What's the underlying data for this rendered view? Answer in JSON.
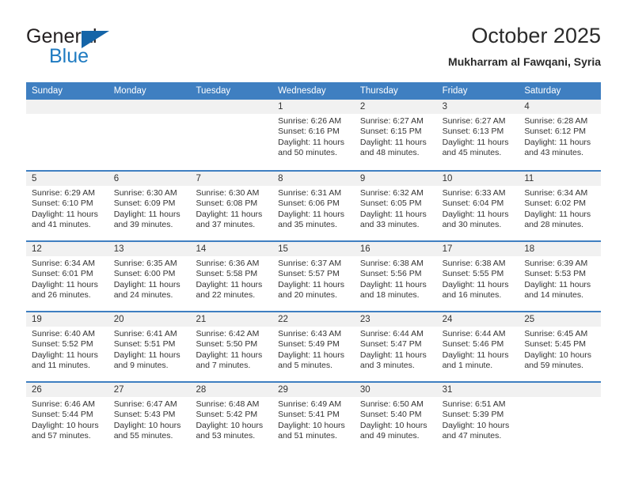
{
  "brand": {
    "name_part1": "General",
    "name_part2": "Blue",
    "accent_color": "#1f7bc1",
    "triangle_color": "#1565a8"
  },
  "header": {
    "month_title": "October 2025",
    "location": "Mukharram al Fawqani, Syria"
  },
  "calendar": {
    "header_color": "#3f7fc1",
    "day_number_band_color": "#f1f1f1",
    "weekdays": [
      "Sunday",
      "Monday",
      "Tuesday",
      "Wednesday",
      "Thursday",
      "Friday",
      "Saturday"
    ],
    "weeks": [
      [
        {
          "date": "",
          "sunrise": "",
          "sunset": "",
          "daylight": "",
          "empty": true
        },
        {
          "date": "",
          "sunrise": "",
          "sunset": "",
          "daylight": "",
          "empty": true
        },
        {
          "date": "",
          "sunrise": "",
          "sunset": "",
          "daylight": "",
          "empty": true
        },
        {
          "date": "1",
          "sunrise": "Sunrise: 6:26 AM",
          "sunset": "Sunset: 6:16 PM",
          "daylight": "Daylight: 11 hours and 50 minutes."
        },
        {
          "date": "2",
          "sunrise": "Sunrise: 6:27 AM",
          "sunset": "Sunset: 6:15 PM",
          "daylight": "Daylight: 11 hours and 48 minutes."
        },
        {
          "date": "3",
          "sunrise": "Sunrise: 6:27 AM",
          "sunset": "Sunset: 6:13 PM",
          "daylight": "Daylight: 11 hours and 45 minutes."
        },
        {
          "date": "4",
          "sunrise": "Sunrise: 6:28 AM",
          "sunset": "Sunset: 6:12 PM",
          "daylight": "Daylight: 11 hours and 43 minutes."
        }
      ],
      [
        {
          "date": "5",
          "sunrise": "Sunrise: 6:29 AM",
          "sunset": "Sunset: 6:10 PM",
          "daylight": "Daylight: 11 hours and 41 minutes."
        },
        {
          "date": "6",
          "sunrise": "Sunrise: 6:30 AM",
          "sunset": "Sunset: 6:09 PM",
          "daylight": "Daylight: 11 hours and 39 minutes."
        },
        {
          "date": "7",
          "sunrise": "Sunrise: 6:30 AM",
          "sunset": "Sunset: 6:08 PM",
          "daylight": "Daylight: 11 hours and 37 minutes."
        },
        {
          "date": "8",
          "sunrise": "Sunrise: 6:31 AM",
          "sunset": "Sunset: 6:06 PM",
          "daylight": "Daylight: 11 hours and 35 minutes."
        },
        {
          "date": "9",
          "sunrise": "Sunrise: 6:32 AM",
          "sunset": "Sunset: 6:05 PM",
          "daylight": "Daylight: 11 hours and 33 minutes."
        },
        {
          "date": "10",
          "sunrise": "Sunrise: 6:33 AM",
          "sunset": "Sunset: 6:04 PM",
          "daylight": "Daylight: 11 hours and 30 minutes."
        },
        {
          "date": "11",
          "sunrise": "Sunrise: 6:34 AM",
          "sunset": "Sunset: 6:02 PM",
          "daylight": "Daylight: 11 hours and 28 minutes."
        }
      ],
      [
        {
          "date": "12",
          "sunrise": "Sunrise: 6:34 AM",
          "sunset": "Sunset: 6:01 PM",
          "daylight": "Daylight: 11 hours and 26 minutes."
        },
        {
          "date": "13",
          "sunrise": "Sunrise: 6:35 AM",
          "sunset": "Sunset: 6:00 PM",
          "daylight": "Daylight: 11 hours and 24 minutes."
        },
        {
          "date": "14",
          "sunrise": "Sunrise: 6:36 AM",
          "sunset": "Sunset: 5:58 PM",
          "daylight": "Daylight: 11 hours and 22 minutes."
        },
        {
          "date": "15",
          "sunrise": "Sunrise: 6:37 AM",
          "sunset": "Sunset: 5:57 PM",
          "daylight": "Daylight: 11 hours and 20 minutes."
        },
        {
          "date": "16",
          "sunrise": "Sunrise: 6:38 AM",
          "sunset": "Sunset: 5:56 PM",
          "daylight": "Daylight: 11 hours and 18 minutes."
        },
        {
          "date": "17",
          "sunrise": "Sunrise: 6:38 AM",
          "sunset": "Sunset: 5:55 PM",
          "daylight": "Daylight: 11 hours and 16 minutes."
        },
        {
          "date": "18",
          "sunrise": "Sunrise: 6:39 AM",
          "sunset": "Sunset: 5:53 PM",
          "daylight": "Daylight: 11 hours and 14 minutes."
        }
      ],
      [
        {
          "date": "19",
          "sunrise": "Sunrise: 6:40 AM",
          "sunset": "Sunset: 5:52 PM",
          "daylight": "Daylight: 11 hours and 11 minutes."
        },
        {
          "date": "20",
          "sunrise": "Sunrise: 6:41 AM",
          "sunset": "Sunset: 5:51 PM",
          "daylight": "Daylight: 11 hours and 9 minutes."
        },
        {
          "date": "21",
          "sunrise": "Sunrise: 6:42 AM",
          "sunset": "Sunset: 5:50 PM",
          "daylight": "Daylight: 11 hours and 7 minutes."
        },
        {
          "date": "22",
          "sunrise": "Sunrise: 6:43 AM",
          "sunset": "Sunset: 5:49 PM",
          "daylight": "Daylight: 11 hours and 5 minutes."
        },
        {
          "date": "23",
          "sunrise": "Sunrise: 6:44 AM",
          "sunset": "Sunset: 5:47 PM",
          "daylight": "Daylight: 11 hours and 3 minutes."
        },
        {
          "date": "24",
          "sunrise": "Sunrise: 6:44 AM",
          "sunset": "Sunset: 5:46 PM",
          "daylight": "Daylight: 11 hours and 1 minute."
        },
        {
          "date": "25",
          "sunrise": "Sunrise: 6:45 AM",
          "sunset": "Sunset: 5:45 PM",
          "daylight": "Daylight: 10 hours and 59 minutes."
        }
      ],
      [
        {
          "date": "26",
          "sunrise": "Sunrise: 6:46 AM",
          "sunset": "Sunset: 5:44 PM",
          "daylight": "Daylight: 10 hours and 57 minutes."
        },
        {
          "date": "27",
          "sunrise": "Sunrise: 6:47 AM",
          "sunset": "Sunset: 5:43 PM",
          "daylight": "Daylight: 10 hours and 55 minutes."
        },
        {
          "date": "28",
          "sunrise": "Sunrise: 6:48 AM",
          "sunset": "Sunset: 5:42 PM",
          "daylight": "Daylight: 10 hours and 53 minutes."
        },
        {
          "date": "29",
          "sunrise": "Sunrise: 6:49 AM",
          "sunset": "Sunset: 5:41 PM",
          "daylight": "Daylight: 10 hours and 51 minutes."
        },
        {
          "date": "30",
          "sunrise": "Sunrise: 6:50 AM",
          "sunset": "Sunset: 5:40 PM",
          "daylight": "Daylight: 10 hours and 49 minutes."
        },
        {
          "date": "31",
          "sunrise": "Sunrise: 6:51 AM",
          "sunset": "Sunset: 5:39 PM",
          "daylight": "Daylight: 10 hours and 47 minutes."
        },
        {
          "date": "",
          "sunrise": "",
          "sunset": "",
          "daylight": "",
          "empty": true
        }
      ]
    ]
  }
}
